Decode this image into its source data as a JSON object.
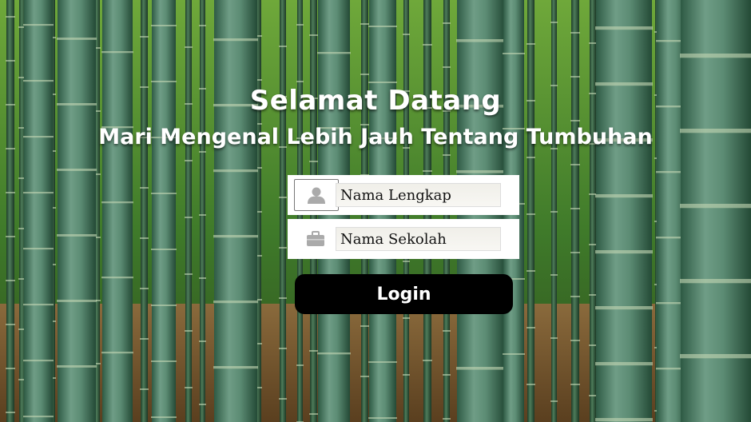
{
  "header": {
    "title": "Selamat Datang",
    "subtitle": "Mari Mengenal Lebih Jauh Tentang Tumbuhan"
  },
  "form": {
    "name_field": {
      "placeholder": "Nama Lengkap",
      "value": "",
      "icon": "user-icon"
    },
    "school_field": {
      "placeholder": "Nama Sekolah",
      "value": "",
      "icon": "briefcase-icon"
    },
    "login_label": "Login"
  },
  "colors": {
    "button_bg": "#000000",
    "button_text": "#ffffff",
    "form_bg": "#ffffff",
    "title_text": "#ffffff"
  },
  "background": "bamboo-forest-photo"
}
